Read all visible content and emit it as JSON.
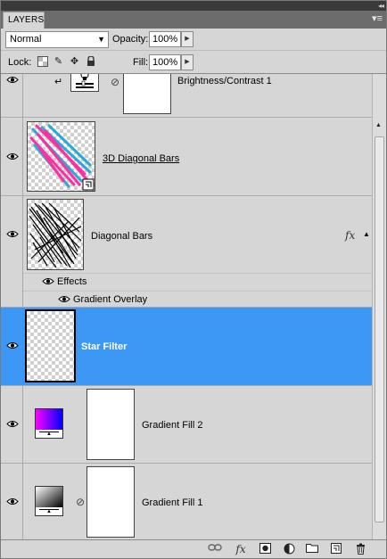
{
  "panel": {
    "tab_label": "LAYERS",
    "collapse_glyph": "◂◂",
    "menu_glyph": "▾≡"
  },
  "blend": {
    "mode": "Normal",
    "opacity_label": "Opacity:",
    "opacity_value": "100%",
    "fill_label": "Fill:",
    "fill_value": "100%",
    "lock_label": "Lock:"
  },
  "layers": [
    {
      "name": "Brightness/Contrast 1",
      "visible": true,
      "type": "adjustment",
      "clipped": true
    },
    {
      "name": "3D Diagonal Bars",
      "visible": true,
      "type": "smart-object"
    },
    {
      "name": "Diagonal Bars",
      "visible": true,
      "type": "pixel",
      "fx": true,
      "effects_label": "Effects",
      "effects": [
        "Gradient Overlay"
      ]
    },
    {
      "name": "Star Filter",
      "visible": true,
      "type": "pixel",
      "selected": true
    },
    {
      "name": "Gradient Fill 2",
      "visible": true,
      "type": "gradient-fill",
      "gradient": [
        "#ff00ff",
        "#0000ff"
      ]
    },
    {
      "name": "Gradient Fill 1",
      "visible": true,
      "type": "gradient-fill",
      "gradient": [
        "#ffffff",
        "#000000"
      ]
    }
  ],
  "colors": {
    "selection": "#3d98f5",
    "panel_bg": "#d6d6d6",
    "titlebar": "#3a3a3a"
  },
  "footer_icons": [
    "link-layers-icon",
    "fx-icon",
    "add-mask-icon",
    "adjustment-layer-icon",
    "new-group-icon",
    "new-layer-icon",
    "trash-icon"
  ],
  "fx_glyph": "fx"
}
